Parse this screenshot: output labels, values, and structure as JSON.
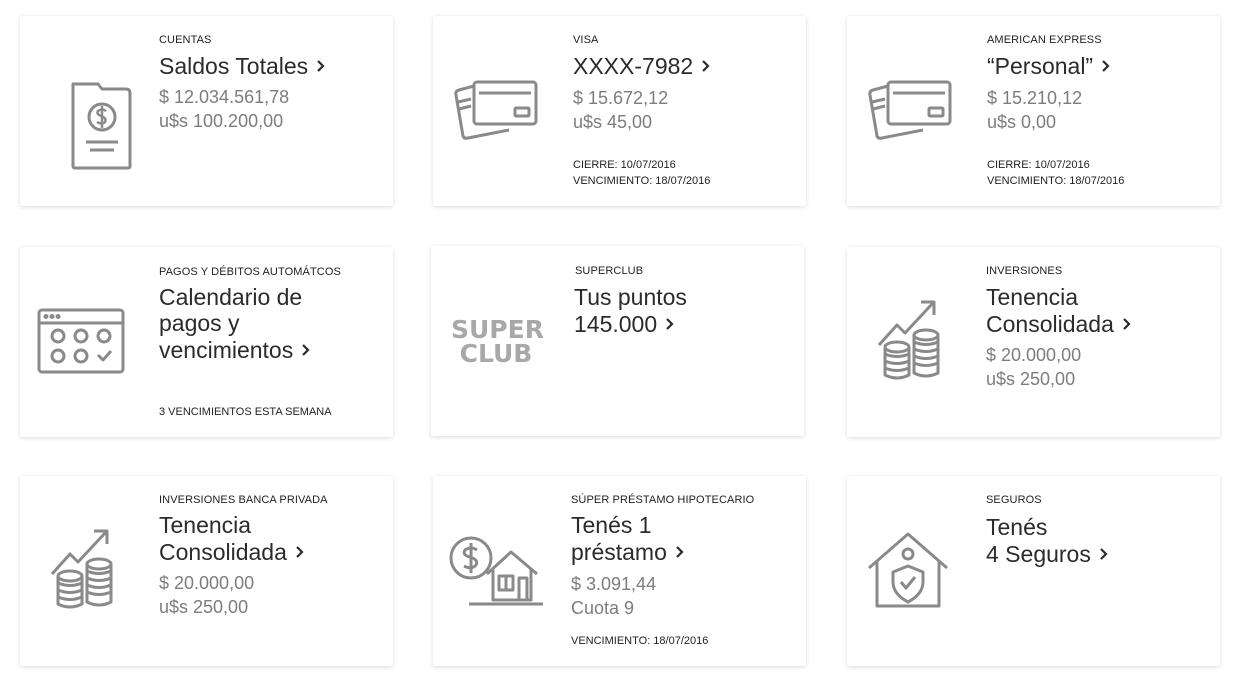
{
  "cards": {
    "cuentas": {
      "category": "CUENTAS",
      "title": "Saldos Totales",
      "line1": "$ 12.034.561,78",
      "line2": "u$s 100.200,00"
    },
    "visa": {
      "category": "VISA",
      "title": "XXXX-7982",
      "line1": "$ 15.672,12",
      "line2": "u$s 45,00",
      "meta1": "CIERRE: 10/07/2016",
      "meta2": "VENCIMIENTO: 18/07/2016"
    },
    "amex": {
      "category": "AMERICAN EXPRESS",
      "title": "“Personal”",
      "line1": "$ 15.210,12",
      "line2": "u$s 0,00",
      "meta1": "CIERRE: 10/07/2016",
      "meta2": "VENCIMIENTO: 18/07/2016"
    },
    "pagos": {
      "category": "PAGOS Y DÉBITOS AUTOMÁTCOS",
      "title1": "Calendario de",
      "title2": "pagos y",
      "title3": "vencimientos",
      "meta1": "3 VENCIMIENTOS ESTA SEMANA"
    },
    "superclub": {
      "category": "SUPERCLUB",
      "title1": "Tus puntos",
      "title2": "145.000",
      "logo1": "SUPER",
      "logo2": "CLUB"
    },
    "inversiones": {
      "category": "INVERSIONES",
      "title1": "Tenencia",
      "title2": "Consolidada",
      "line1": "$ 20.000,00",
      "line2": "u$s 250,00"
    },
    "banca_privada": {
      "category": "INVERSIONES BANCA PRIVADA",
      "title1": "Tenencia",
      "title2": "Consolidada",
      "line1": "$ 20.000,00",
      "line2": "u$s 250,00"
    },
    "prestamo": {
      "category": "SÚPER PRÉSTAMO HIPOTECARIO",
      "title1": "Tenés 1",
      "title2": "préstamo",
      "line1": "$ 3.091,44",
      "line2": "Cuota 9",
      "meta1": "VENCIMIENTO: 18/07/2016"
    },
    "seguros": {
      "category": "SEGUROS",
      "title1": "Tenés",
      "title2": "4 Seguros"
    }
  },
  "colors": {
    "icon": "#8a8a8a",
    "text": "#2b2b2b",
    "muted": "#7d7d7d",
    "logo": "#a8a8a8"
  },
  "icons": {
    "cuentas": "dollar-document-icon",
    "visa": "credit-cards-icon",
    "amex": "credit-cards-icon",
    "pagos": "calendar-icon",
    "inversiones": "coins-growth-icon",
    "banca_privada": "coins-growth-icon",
    "prestamo": "house-loan-icon",
    "seguros": "house-shield-icon",
    "chevron": "chevron-right-icon"
  }
}
